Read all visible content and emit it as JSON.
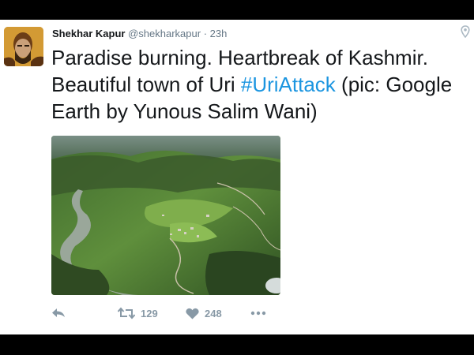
{
  "tweet": {
    "author_name": "Shekhar Kapur",
    "handle": "@shekharkapur",
    "separator": "·",
    "time": "23h",
    "text_before": "Paradise burning. Heartbreak of Kashmir. Beautiful town of Uri ",
    "hashtag": "#UriAttack",
    "text_after": " (pic: Google Earth by Yunous Salim Wani)"
  },
  "actions": {
    "retweet_count": "129",
    "like_count": "248"
  },
  "colors": {
    "hashtag": "#1b95e0",
    "text": "#14171a",
    "muted": "#8899a6"
  },
  "icons": [
    "avatar",
    "location-pin-icon",
    "reply-icon",
    "retweet-icon",
    "like-heart-icon",
    "more-dots-icon"
  ]
}
